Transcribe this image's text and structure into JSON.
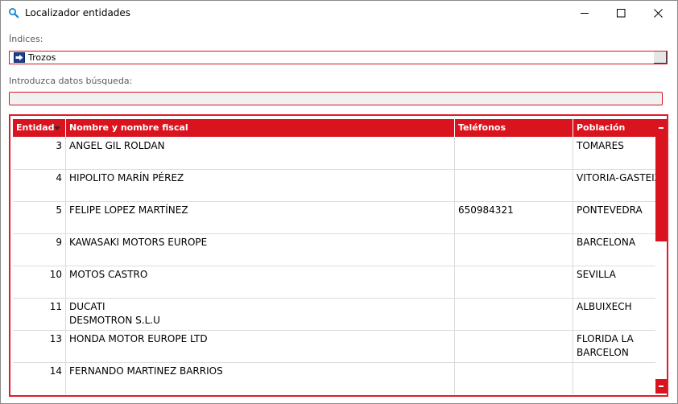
{
  "window": {
    "title": "Localizador entidades",
    "icons": {
      "app": "search-icon",
      "minimize": "minimize-icon",
      "maximize": "maximize-icon",
      "close": "close-icon"
    }
  },
  "form": {
    "indices_label": "Índices:",
    "indices_value": "Trozos",
    "indices_icon": "arrow-right-icon",
    "search_label": "Introduzca datos búsqueda:",
    "search_value": ""
  },
  "colors": {
    "accent": "#d9141e",
    "frame": "#e01b2a",
    "search_bg": "#f1f1f1"
  },
  "grid": {
    "columns": [
      {
        "key": "entidad",
        "label": "Entidad",
        "sorted": "descending"
      },
      {
        "key": "nombre",
        "label": "Nombre y nombre fiscal"
      },
      {
        "key": "telefonos",
        "label": "Teléfonos"
      },
      {
        "key": "poblacion",
        "label": "Población"
      }
    ],
    "rows": [
      {
        "entidad": "3",
        "nombre1": "ANGEL GIL ROLDAN",
        "nombre2": "",
        "telefonos": "",
        "pob1": "TOMARES",
        "pob2": ""
      },
      {
        "entidad": "4",
        "nombre1": "HIPOLITO MARÍN PÉREZ",
        "nombre2": "",
        "telefonos": "",
        "pob1": "VITORIA-GASTEIZ",
        "pob2": ""
      },
      {
        "entidad": "5",
        "nombre1": "FELIPE LOPEZ MARTÍNEZ",
        "nombre2": "",
        "telefonos": "650984321",
        "pob1": "PONTEVEDRA",
        "pob2": ""
      },
      {
        "entidad": "9",
        "nombre1": "KAWASAKI MOTORS EUROPE",
        "nombre2": "",
        "telefonos": "",
        "pob1": "BARCELONA",
        "pob2": ""
      },
      {
        "entidad": "10",
        "nombre1": "MOTOS CASTRO",
        "nombre2": "",
        "telefonos": "",
        "pob1": "SEVILLA",
        "pob2": ""
      },
      {
        "entidad": "11",
        "nombre1": "DUCATI",
        "nombre2": "DESMOTRON S.L.U",
        "telefonos": "",
        "pob1": "ALBUIXECH",
        "pob2": ""
      },
      {
        "entidad": "13",
        "nombre1": "HONDA MOTOR EUROPE LTD",
        "nombre2": "",
        "telefonos": "",
        "pob1": "FLORIDA  LA",
        "pob2": "BARCELON"
      },
      {
        "entidad": "14",
        "nombre1": "FERNANDO MARTINEZ BARRIOS",
        "nombre2": "",
        "telefonos": "",
        "pob1": "",
        "pob2": ""
      }
    ]
  }
}
